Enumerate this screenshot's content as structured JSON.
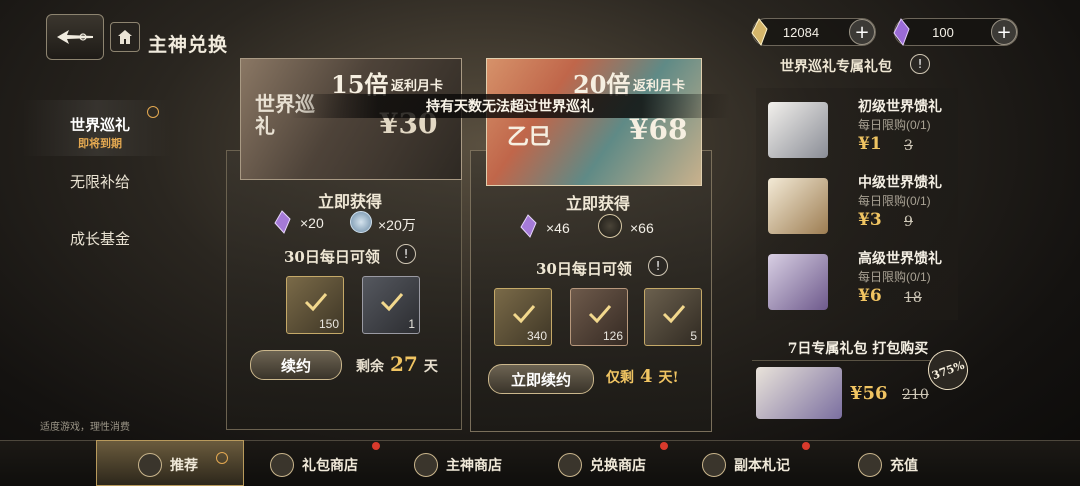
{
  "header": {
    "title": "主神兑换"
  },
  "currency": [
    {
      "icon": "gold-crystal-icon",
      "value": "12084"
    },
    {
      "icon": "purple-crystal-icon",
      "value": "100"
    }
  ],
  "menu": {
    "items": [
      {
        "label": "世界巡礼",
        "sub": "即将到期"
      },
      {
        "label": "无限补给"
      },
      {
        "label": "成长基金"
      }
    ]
  },
  "card1": {
    "banner_mult": "15倍",
    "banner_tag": "返利月卡",
    "banner_name": "世界巡礼",
    "banner_price": "¥30",
    "get_label": "立即获得",
    "rewards": [
      {
        "qty": "×20"
      },
      {
        "qty": "×20万"
      }
    ],
    "daily_label": "30日每日可领",
    "slots": [
      "150",
      "1"
    ],
    "renew_label": "续约",
    "remain_prefix": "剩余",
    "remain_days": "27",
    "remain_suffix": "天"
  },
  "card2": {
    "banner_mult": "20倍",
    "banner_tag": "返利月卡",
    "banner_name": "乙巳",
    "banner_price": "¥68",
    "overlay_text": "持有天数无法超过世界巡礼",
    "get_label": "立即获得",
    "rewards": [
      {
        "qty": "×46"
      },
      {
        "qty": "×66"
      }
    ],
    "daily_label": "30日每日可领",
    "slots": [
      "340",
      "126",
      "5"
    ],
    "renew_label": "立即续约",
    "remain_prefix": "仅剩",
    "remain_days": "4",
    "remain_suffix": "天!"
  },
  "right_panel": {
    "title": "世界巡礼专属礼包",
    "gifts": [
      {
        "name": "初级世界馈礼",
        "limit": "每日限购(0/1)",
        "price": "¥1",
        "old_price": "3"
      },
      {
        "name": "中级世界馈礼",
        "limit": "每日限购(0/1)",
        "price": "¥3",
        "old_price": "9"
      },
      {
        "name": "高级世界馈礼",
        "limit": "每日限购(0/1)",
        "price": "¥6",
        "old_price": "18"
      }
    ],
    "bundle_title": "7日专属礼包 打包购买",
    "bundle_price": "¥56",
    "bundle_old": "210",
    "bundle_badge": "375%"
  },
  "footer_note": "适度游戏，理性消费",
  "bottom_nav": [
    {
      "label": "推荐"
    },
    {
      "label": "礼包商店"
    },
    {
      "label": "主神商店"
    },
    {
      "label": "兑换商店"
    },
    {
      "label": "副本札记"
    },
    {
      "label": "充值"
    }
  ]
}
